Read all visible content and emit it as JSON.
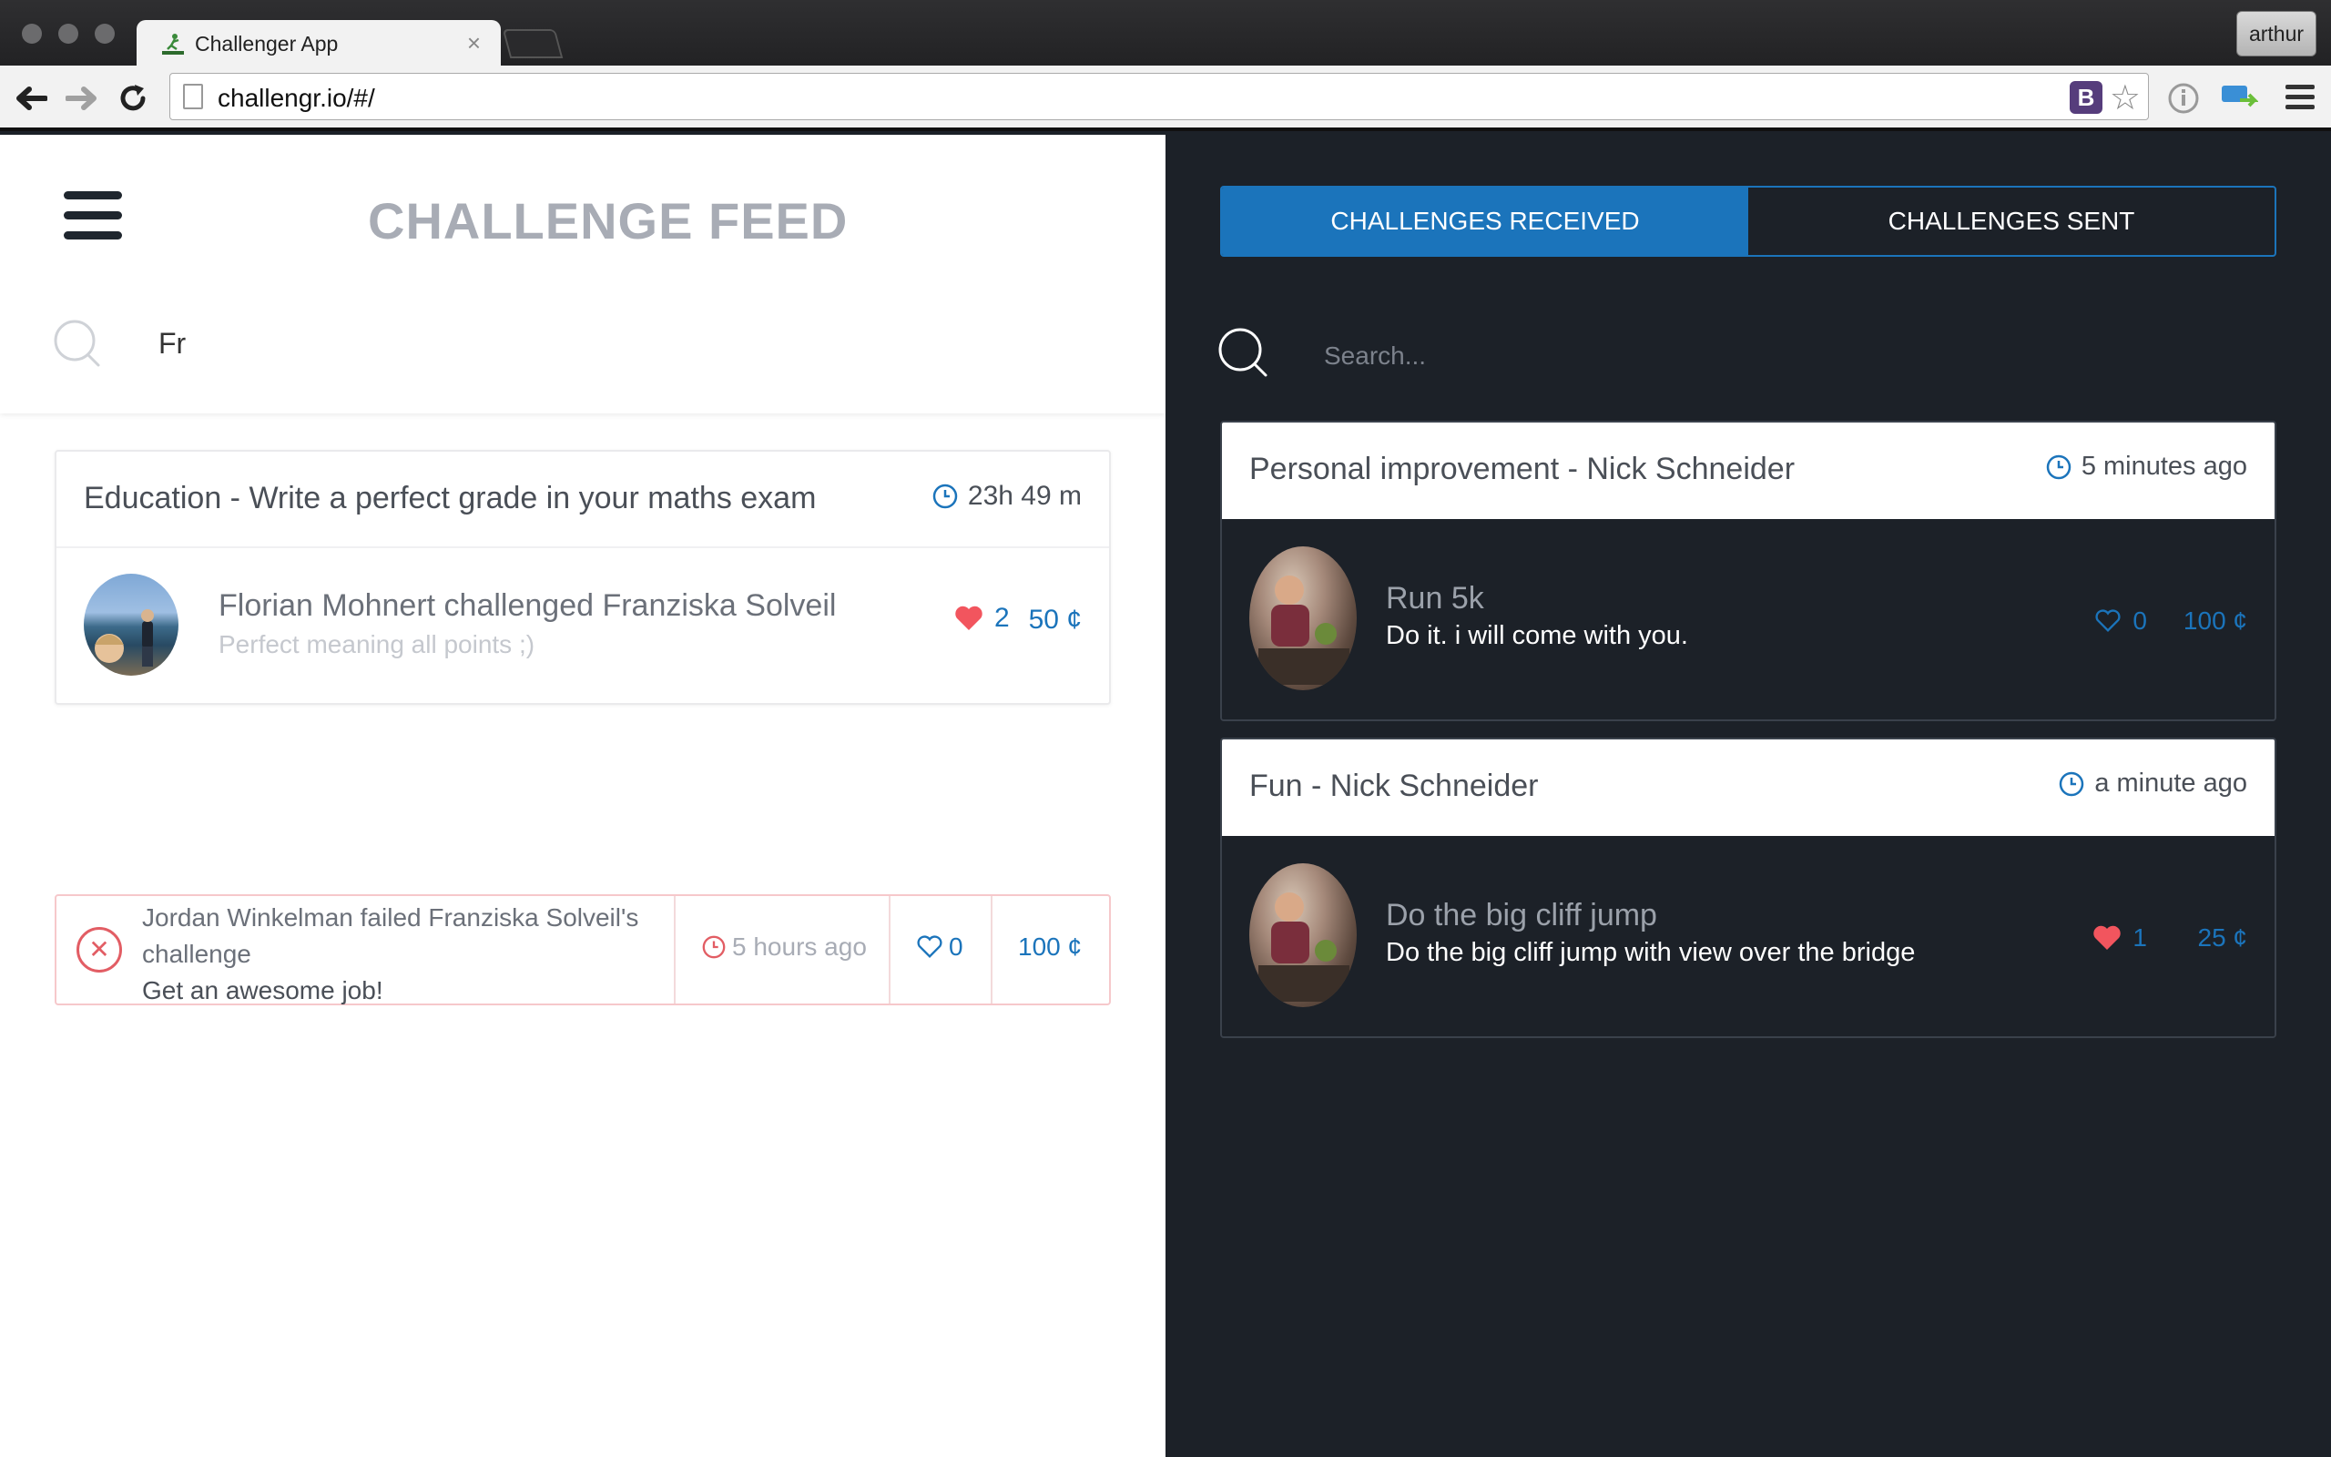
{
  "browser": {
    "tab_title": "Challenger App",
    "url": "challengr.io/#/",
    "profile_name": "arthur"
  },
  "left": {
    "title": "CHALLENGE FEED",
    "search_value": "Fr",
    "feed_card": {
      "title": "Education - Write a perfect grade in your maths exam",
      "time": "23h 49 m",
      "headline": "Florian Mohnert challenged Franziska Solveil",
      "subline": "Perfect meaning all points ;)",
      "likes": "2",
      "cents": "50 ¢"
    },
    "fail_card": {
      "line1": "Jordan Winkelman failed Franziska Solveil's",
      "line2": "challenge",
      "line3": "Get an awesome job!",
      "time": "5 hours ago",
      "likes": "0",
      "cents": "100 ¢"
    }
  },
  "right": {
    "tabs": [
      {
        "label": "CHALLENGES RECEIVED",
        "active": true
      },
      {
        "label": "CHALLENGES SENT",
        "active": false
      }
    ],
    "search_placeholder": "Search...",
    "cards": [
      {
        "title": "Personal improvement - Nick Schneider",
        "time": "5 minutes ago",
        "name": "Run 5k",
        "desc": "Do it. i will come with you.",
        "likes": "0",
        "liked": false,
        "cents": "100 ¢"
      },
      {
        "title": "Fun - Nick Schneider",
        "time": "a minute ago",
        "name": "Do the big cliff jump",
        "desc": "Do the big cliff jump with view over the bridge",
        "likes": "1",
        "liked": true,
        "cents": "25 ¢"
      }
    ]
  },
  "colors": {
    "accent": "#1b74bb",
    "dark_bg": "#1c2128",
    "heart": "#f2555e",
    "fail": "#e25d64"
  }
}
